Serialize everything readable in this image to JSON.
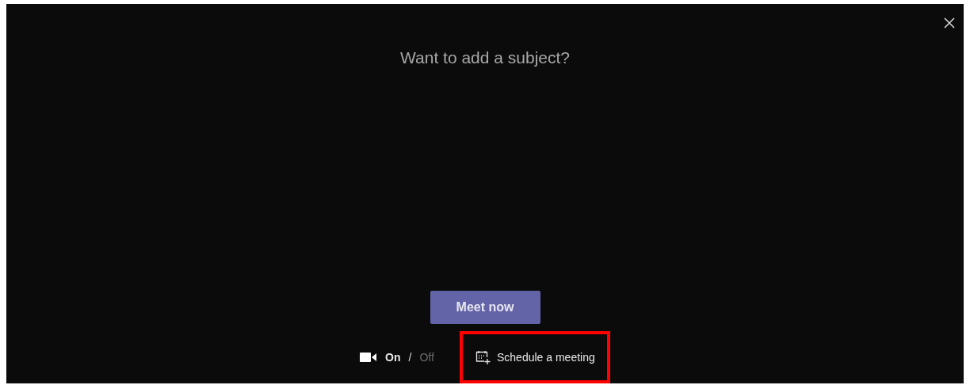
{
  "subject_field": {
    "placeholder": "Want to add a subject?"
  },
  "primary_button": {
    "label": "Meet now"
  },
  "camera_toggle": {
    "options": [
      {
        "label": "On",
        "selected": true
      },
      {
        "label": "Off",
        "selected": false
      }
    ],
    "separator": "/"
  },
  "schedule_link": {
    "label": "Schedule a meeting",
    "highlighted": true
  }
}
